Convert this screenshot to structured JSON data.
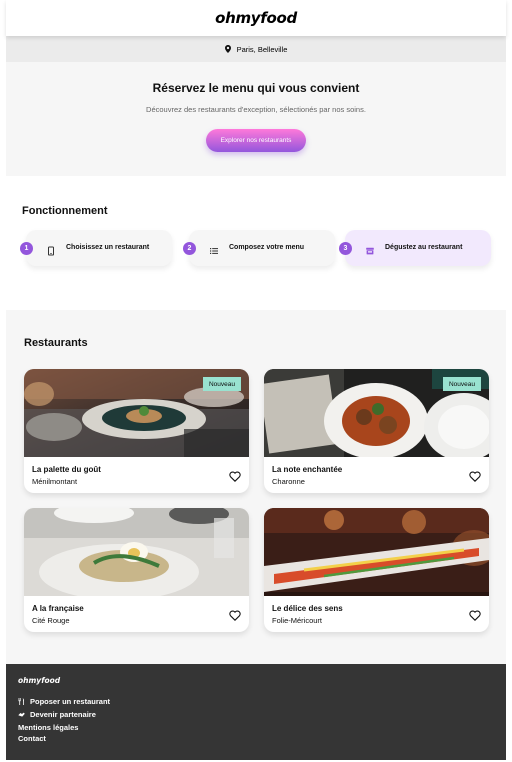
{
  "header": {
    "logo": "ohmyfood"
  },
  "location": {
    "icon": "map-pin-icon",
    "text": "Paris, Belleville"
  },
  "hero": {
    "title": "Réservez le menu qui vous convient",
    "subtitle": "Découvrez des restaurants d'exception, sélectionés par nos soins.",
    "cta": "Explorer nos restaurants"
  },
  "steps": {
    "title": "Fonctionnement",
    "items": [
      {
        "num": "1",
        "icon": "phone-icon",
        "label": "Choisissez un restaurant"
      },
      {
        "num": "2",
        "icon": "list-icon",
        "label": "Composez votre menu"
      },
      {
        "num": "3",
        "icon": "store-icon",
        "label": "Dégustez au restaurant"
      }
    ]
  },
  "restaurants": {
    "title": "Restaurants",
    "items": [
      {
        "name": "La palette du goût",
        "location": "Ménilmontant",
        "badge": "Nouveau"
      },
      {
        "name": "La note enchantée",
        "location": "Charonne",
        "badge": "Nouveau"
      },
      {
        "name": "A la française",
        "location": "Cité Rouge",
        "badge": ""
      },
      {
        "name": "Le délice des sens",
        "location": "Folie-Méricourt",
        "badge": ""
      }
    ]
  },
  "footer": {
    "logo": "ohmyfood",
    "links": [
      {
        "icon": "utensils-icon",
        "label": "Poposer un restaurant"
      },
      {
        "icon": "handshake-icon",
        "label": "Devenir partenaire"
      },
      {
        "icon": "",
        "label": "Mentions légales"
      },
      {
        "icon": "",
        "label": "Contact"
      }
    ]
  },
  "colors": {
    "accent": "#9356dc",
    "accent_pink": "#ff79da",
    "badge": "#99e2d0",
    "footer": "#353535"
  }
}
